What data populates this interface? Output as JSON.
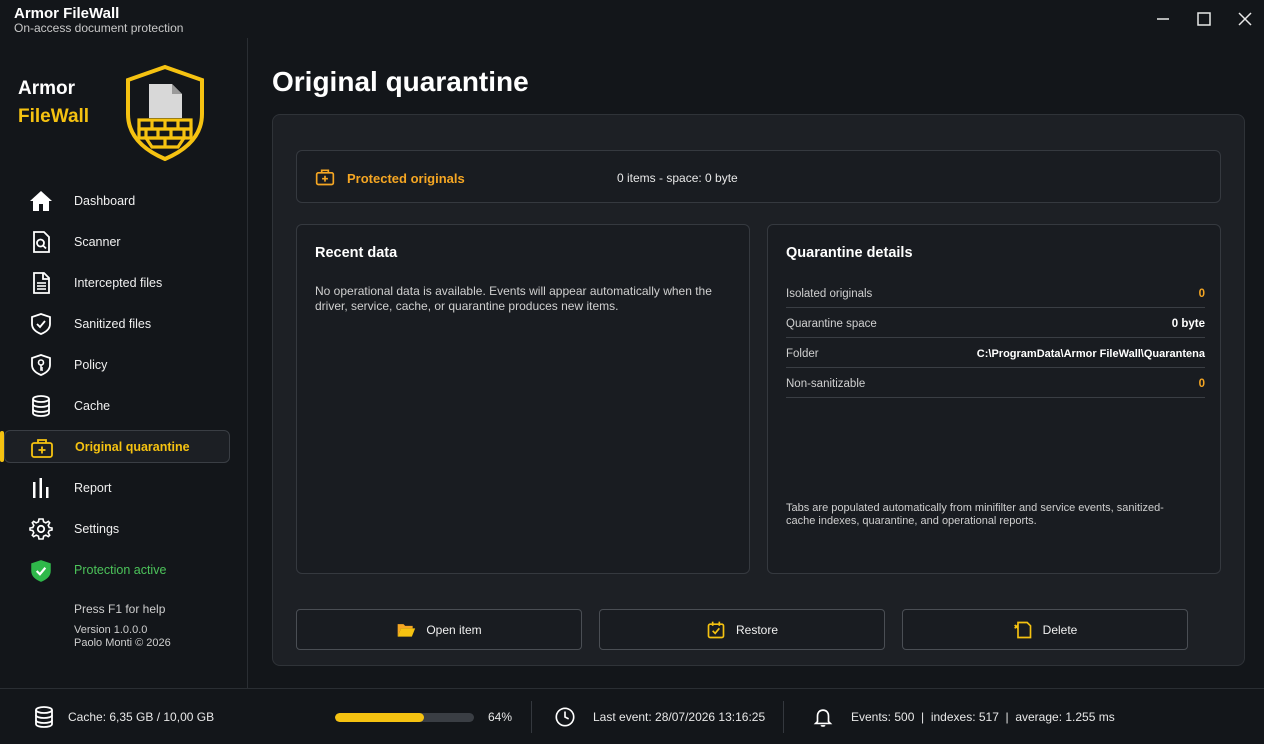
{
  "window": {
    "title": "Armor FileWall",
    "subtitle": "On-access document protection",
    "controls": [
      "minimize-icon",
      "maximize-icon",
      "close-icon"
    ]
  },
  "brand": {
    "line1": "Armor",
    "line2": "FileWall",
    "logo_icon": "shield-firewall-logo"
  },
  "sidebar": {
    "items": [
      {
        "label": "Dashboard",
        "icon": "home-icon",
        "active": false
      },
      {
        "label": "Scanner",
        "icon": "document-search-icon",
        "active": false
      },
      {
        "label": "Intercepted files",
        "icon": "document-lines-icon",
        "active": false
      },
      {
        "label": "Sanitized files",
        "icon": "shield-check-icon",
        "active": false
      },
      {
        "label": "Policy",
        "icon": "shield-key-icon",
        "active": false
      },
      {
        "label": "Cache",
        "icon": "database-icon",
        "active": false
      },
      {
        "label": "Original quarantine",
        "icon": "medical-case-icon",
        "active": true
      },
      {
        "label": "Report",
        "icon": "bar-chart-icon",
        "active": false
      },
      {
        "label": "Settings",
        "icon": "gear-icon",
        "active": false
      }
    ],
    "protection_status": "Protection active",
    "help": "Press F1 for help",
    "version": "Version 1.0.0.0",
    "copyright": "Paolo Monti © 2026"
  },
  "main": {
    "page_title": "Original quarantine",
    "summary": {
      "label": "Protected originals",
      "stats": "0 items - space: 0 byte"
    },
    "recent": {
      "title": "Recent data",
      "message": "No operational data is available. Events will appear automatically when the driver, service, cache, or quarantine produces new items."
    },
    "details": {
      "title": "Quarantine details",
      "rows": [
        {
          "label": "Isolated originals",
          "value": "0"
        },
        {
          "label": "Quarantine space",
          "value": "0 byte"
        },
        {
          "label": "Folder",
          "value": "C:\\ProgramData\\Armor FileWall\\Quarantena"
        },
        {
          "label": "Non-sanitizable",
          "value": "0"
        }
      ],
      "note": "Tabs are populated automatically from minifilter and service events, sanitized-cache indexes, quarantine, and operational reports."
    },
    "actions": {
      "open": "Open item",
      "restore": "Restore",
      "delete": "Delete"
    }
  },
  "statusbar": {
    "cache": "Cache: 6,35 GB / 10,00 GB",
    "cache_usage_fraction": 0.64,
    "cache_percent": "64%",
    "last_event": "Last event: 28/07/2026 13:16:25",
    "events": "Events: 500  |  indexes: 517  |  average: 1.255 ms"
  },
  "colors": {
    "accent_yellow": "#f5c211",
    "accent_orange": "#f5a623",
    "status_green": "#4cc35a",
    "background": "#13161a",
    "panel": "#1d2025"
  }
}
